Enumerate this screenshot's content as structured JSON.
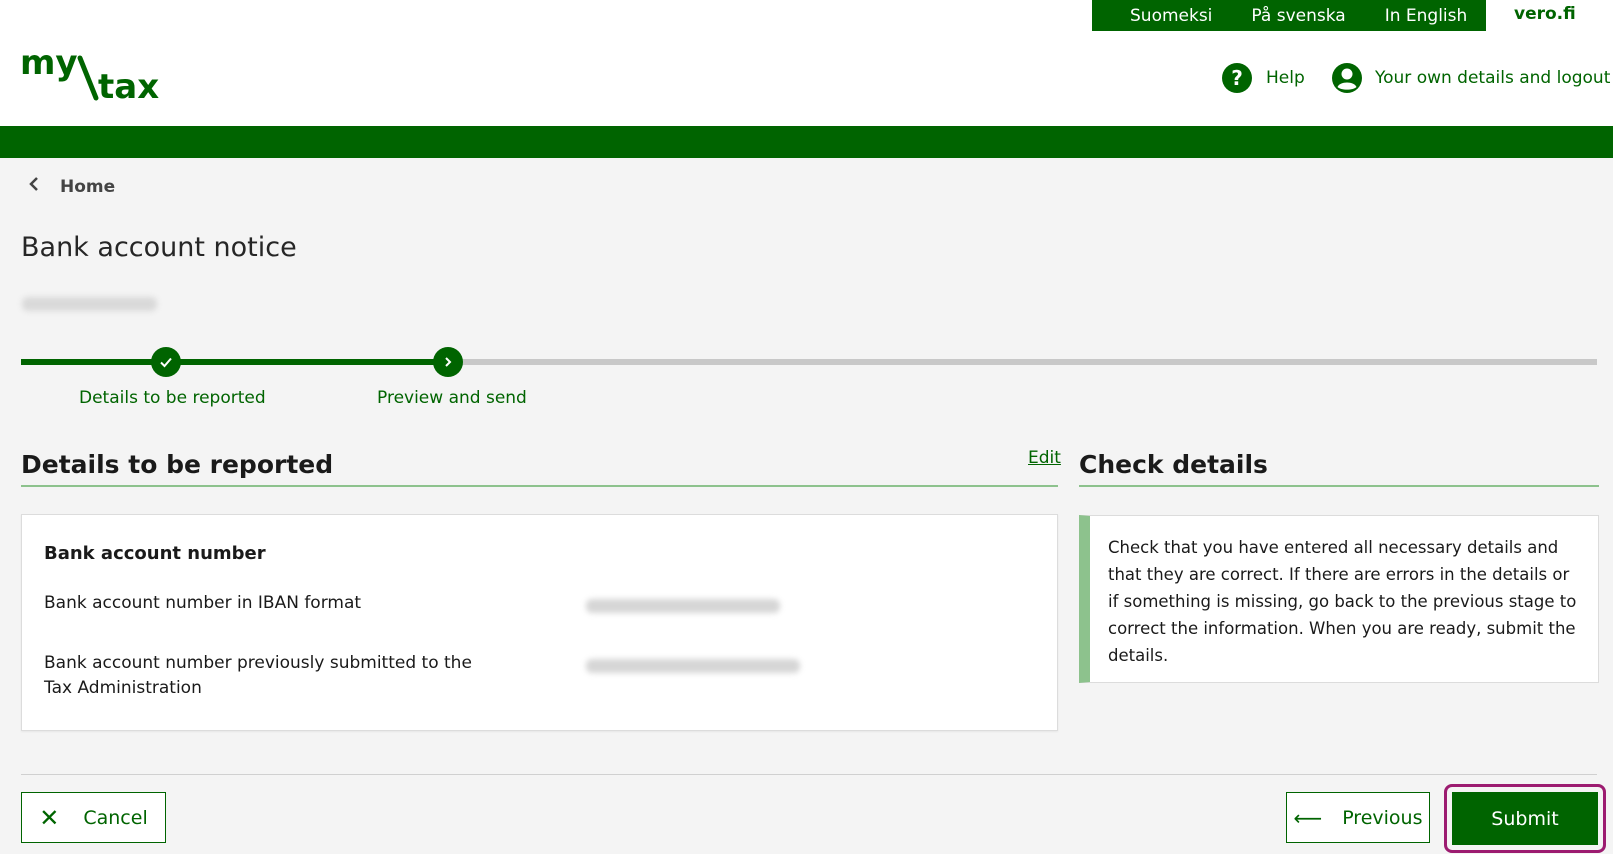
{
  "header": {
    "languages": [
      "Suomeksi",
      "På svenska",
      "In English"
    ],
    "vero_link": "vero.fi",
    "logo_text": "my/tax",
    "help_label": "Help",
    "account_label": "Your own details and logout"
  },
  "breadcrumb": {
    "home": "Home"
  },
  "page": {
    "title": "Bank account notice"
  },
  "stepper": {
    "steps": [
      {
        "label": "Details to be reported",
        "state": "done"
      },
      {
        "label": "Preview and send",
        "state": "current"
      }
    ]
  },
  "details": {
    "section_title": "Details to be reported",
    "edit_label": "Edit",
    "card_heading": "Bank account number",
    "rows": [
      {
        "label": "Bank account number in IBAN format"
      },
      {
        "label": "Bank account number previously submitted to the Tax Administration"
      }
    ]
  },
  "check": {
    "section_title": "Check details",
    "text": "Check that you have entered all necessary details and that they are correct. If there are errors in the details or if something is missing, go back to the previous stage to correct the information. When you are ready, submit the details."
  },
  "footer": {
    "cancel_label": "Cancel",
    "previous_label": "Previous",
    "submit_label": "Submit"
  },
  "colors": {
    "brand_green": "#006400",
    "accent_light_green": "#8dc28d",
    "focus_ring": "#9c1b70"
  }
}
